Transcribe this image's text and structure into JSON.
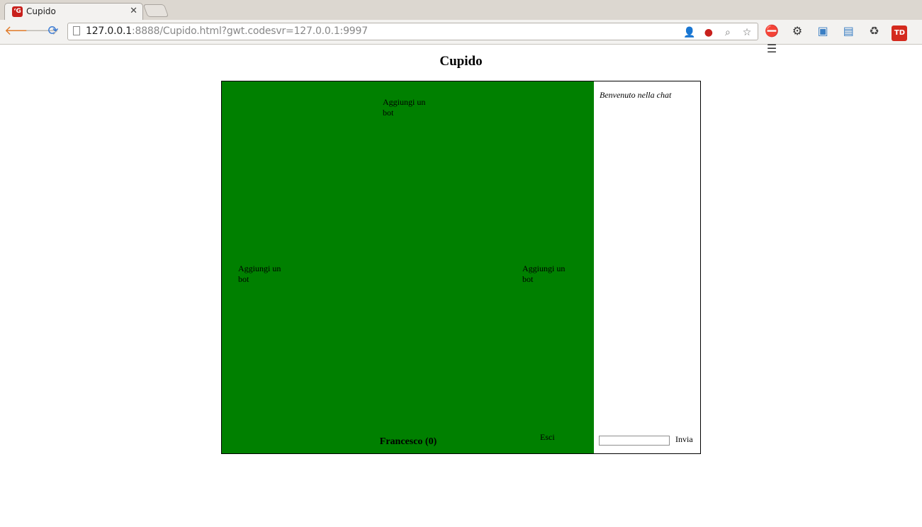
{
  "browser": {
    "tab_title": "Cupido",
    "tab_favicon": "cupido-favicon",
    "url_host": "127.0.0.1",
    "url_rest": ":8888/Cupido.html?gwt.codesvr=127.0.0.1:9997"
  },
  "page": {
    "title": "Cupido"
  },
  "table": {
    "background": "#008000",
    "bot_slots": [
      {
        "label": "Aggiungi un bot",
        "position": "top"
      },
      {
        "label": "Aggiungi un bot",
        "position": "left"
      },
      {
        "label": "Aggiungi un bot",
        "position": "right"
      }
    ],
    "player_name": "Francesco (0)",
    "exit_label": "Esci"
  },
  "chat": {
    "welcome": "Benvenuto nella chat",
    "input_value": "",
    "send_label": "Invia"
  }
}
